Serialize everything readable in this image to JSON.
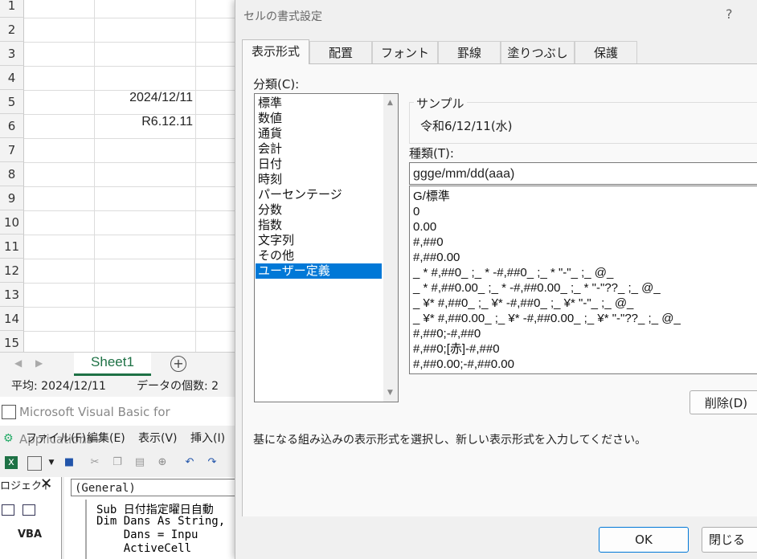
{
  "excel": {
    "row_numbers": [
      "1",
      "2",
      "3",
      "4",
      "5",
      "6",
      "7",
      "8",
      "9",
      "10",
      "11",
      "12",
      "13",
      "14",
      "15"
    ],
    "cells": {
      "r5": "2024/12/11",
      "r6": "R6.12.11"
    },
    "sheet_tab": "Sheet1",
    "add_sheet": "+",
    "status": {
      "average": "平均: 2024/12/11",
      "count": "データの個数: 2"
    }
  },
  "vba": {
    "title": "Microsoft Visual Basic for Applications -",
    "menu": {
      "file": "ファイル(F)",
      "edit": "編集(E)",
      "view": "表示(V)",
      "insert": "挿入(I)"
    },
    "project_label": "ロジェクト",
    "project_item": "VBA",
    "general": "(General)",
    "code": [
      "Sub 日付指定曜日自動",
      "Dim Dans As String,",
      "    Dans = Inpu",
      "    ActiveCell"
    ]
  },
  "dialog": {
    "title": "セルの書式設定",
    "help": "?",
    "tabs": [
      "表示形式",
      "配置",
      "フォント",
      "罫線",
      "塗りつぶし",
      "保護"
    ],
    "category_label": "分類(C):",
    "categories": [
      "標準",
      "数値",
      "通貨",
      "会計",
      "日付",
      "時刻",
      "パーセンテージ",
      "分数",
      "指数",
      "文字列",
      "その他",
      "ユーザー定義"
    ],
    "selected_category": "ユーザー定義",
    "sample_label": "サンプル",
    "sample_value": "令和6/12/11(水)",
    "type_label": "種類(T):",
    "type_value": "ggge/mm/dd(aaa)",
    "formats": [
      "G/標準",
      "0",
      "0.00",
      "#,##0",
      "#,##0.00",
      "_ * #,##0_ ;_ * -#,##0_ ;_ * \"-\"_ ;_ @_",
      "_ * #,##0.00_ ;_ * -#,##0.00_ ;_ * \"-\"??_ ;_ @_",
      "_ ¥* #,##0_ ;_ ¥* -#,##0_ ;_ ¥* \"-\"_ ;_ @_",
      "_ ¥* #,##0.00_ ;_ ¥* -#,##0.00_ ;_ ¥* \"-\"??_ ;_ @_",
      "#,##0;-#,##0",
      "#,##0;[赤]-#,##0",
      "#,##0.00;-#,##0.00"
    ],
    "delete_button": "削除(D)",
    "hint": "基になる組み込みの表示形式を選択し、新しい表示形式を入力してください。",
    "ok_button": "OK",
    "close_button": "閉じる"
  }
}
